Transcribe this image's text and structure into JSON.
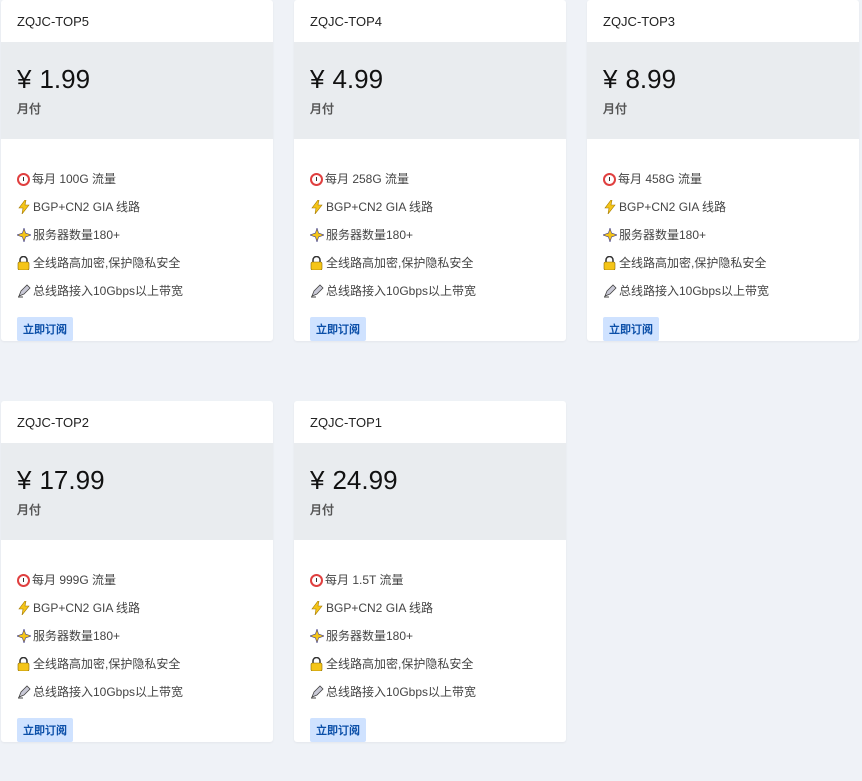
{
  "plans": [
    {
      "name": "ZQJC-TOP5",
      "currency": "¥",
      "price": "1.99",
      "period": "月付",
      "traffic": "每月 100G 流量"
    },
    {
      "name": "ZQJC-TOP4",
      "currency": "¥",
      "price": "4.99",
      "period": "月付",
      "traffic": "每月 258G 流量"
    },
    {
      "name": "ZQJC-TOP3",
      "currency": "¥",
      "price": "8.99",
      "period": "月付",
      "traffic": "每月 458G 流量"
    },
    {
      "name": "ZQJC-TOP2",
      "currency": "¥",
      "price": "17.99",
      "period": "月付",
      "traffic": "每月 999G 流量"
    },
    {
      "name": "ZQJC-TOP1",
      "currency": "¥",
      "price": "24.99",
      "period": "月付",
      "traffic": "每月 1.5T 流量"
    }
  ],
  "features": {
    "route": "BGP+CN2 GIA 线路",
    "servers": "服务器数量180+",
    "security": "全线路高加密,保护隐私安全",
    "bandwidth": "总线路接入10Gbps以上带宽"
  },
  "icons": {
    "traffic": "alarm-clock-icon",
    "route": "lightning-icon",
    "servers": "sparkle-icon",
    "security": "lock-icon",
    "bandwidth": "pen-icon"
  },
  "subscribe_label": "立即订阅",
  "colors": {
    "page_bg": "#eff2f7",
    "price_bg": "#e9ecef",
    "button_bg": "#cfe2ff",
    "button_text": "#0b4fa8"
  }
}
